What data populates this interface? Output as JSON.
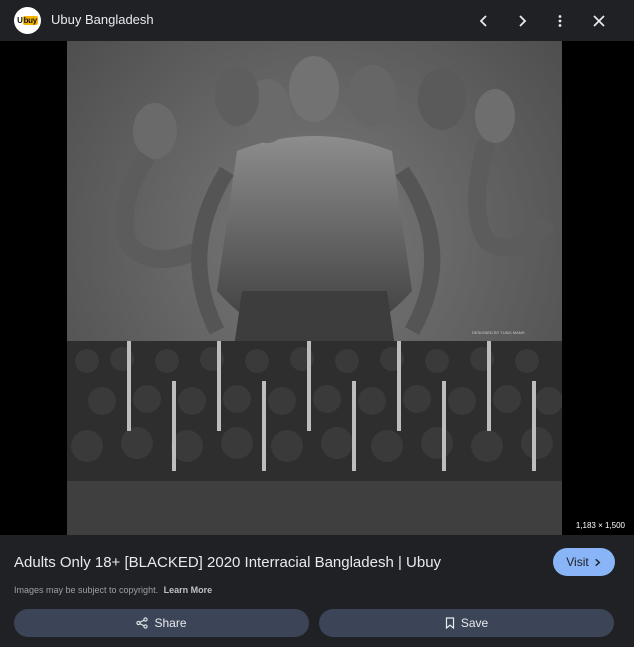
{
  "header": {
    "logo_text_part1": "U",
    "logo_text_part2": "buy",
    "site_name": "Ubuy Bangladesh",
    "icons": [
      "chevron-left-icon",
      "chevron-right-icon",
      "more-vert-icon",
      "close-icon"
    ]
  },
  "image": {
    "dimensions_label": "1,183 × 1,500",
    "watermark_text": "DESIGNED BY TUNG MANH"
  },
  "details": {
    "title": "Adults Only 18+ [BLACKED] 2020 Interracial Bangladesh | Ubuy",
    "visit_label": "Visit",
    "copyright_text": "Images may be subject to copyright.",
    "learn_more_label": "Learn More"
  },
  "actions": {
    "share_label": "Share",
    "save_label": "Save"
  },
  "colors": {
    "background": "#202124",
    "accent": "#8ab4f8",
    "button_bg": "#3c4557"
  }
}
